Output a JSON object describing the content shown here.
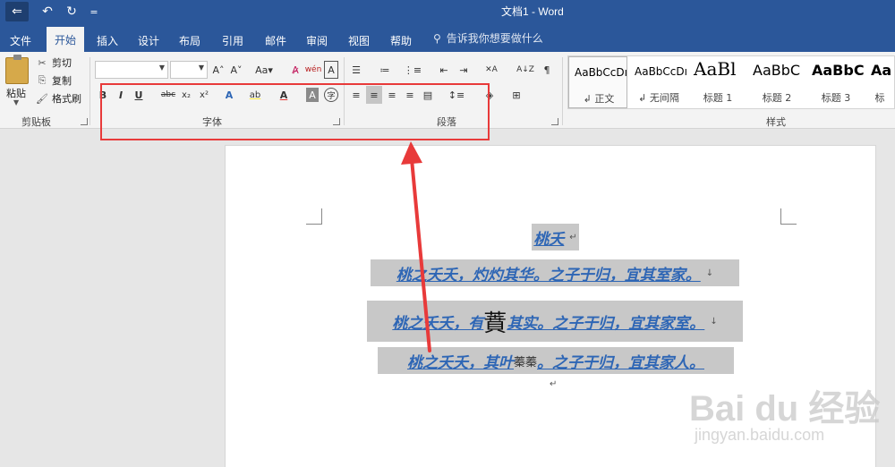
{
  "titlebar": {
    "title": "文档1  -  Word",
    "home_icon": "⇐",
    "undo_icon": "↶",
    "redo_icon": "↻",
    "more_icon": "="
  },
  "tabs": [
    {
      "label": "文件"
    },
    {
      "label": "开始"
    },
    {
      "label": "插入"
    },
    {
      "label": "设计"
    },
    {
      "label": "布局"
    },
    {
      "label": "引用"
    },
    {
      "label": "邮件"
    },
    {
      "label": "审阅"
    },
    {
      "label": "视图"
    },
    {
      "label": "帮助"
    }
  ],
  "tell_me": {
    "icon": "⚲",
    "text": "告诉我你想要做什么"
  },
  "clipboard": {
    "paste": "粘贴",
    "cut": "剪切",
    "copy": "复制",
    "format_painter": "格式刷",
    "group": "剪贴板",
    "cut_icon": "✂",
    "copy_icon": "⎘",
    "painter_icon": "🖌"
  },
  "font": {
    "group": "字体",
    "grow": "A˄",
    "shrink": "A˅",
    "case": "Aa▾",
    "clear": "A̷",
    "phonetic": "wén",
    "border": "A",
    "bold": "B",
    "italic": "I",
    "underline": "U",
    "strike": "abc",
    "sub": "x₂",
    "sup": "x²",
    "effects": "A",
    "highlight": "ab",
    "color": "A",
    "shade": "A",
    "enclose": "字"
  },
  "paragraph": {
    "group": "段落",
    "bullets": "☰",
    "numbering": "≔",
    "multilevel": "⋮≡",
    "decrease": "⇤",
    "increase": "⇥",
    "chinese": "✕A",
    "sort": "A↓Z",
    "marks": "¶",
    "align_left": "≡",
    "align_center": "≡",
    "align_right": "≡",
    "justify": "≡",
    "distributed": "▤",
    "spacing": "↕≡",
    "shading": "◈",
    "borders": "⊞"
  },
  "styles": {
    "group": "样式",
    "items": [
      {
        "preview": "AaBbCcDı",
        "name": "↲ 正文"
      },
      {
        "preview": "AaBbCcDı",
        "name": "↲ 无间隔"
      },
      {
        "preview": "AaBl",
        "name": "标题 1"
      },
      {
        "preview": "AaBbC",
        "name": "标题 2"
      },
      {
        "preview": "AaBbC",
        "name": "标题 3"
      },
      {
        "preview": "Aa",
        "name": "标"
      }
    ]
  },
  "document": {
    "title": "桃夭",
    "line1": "桃之夭夭，灼灼其华。之子于归，宜其室家。",
    "line2a": "桃之夭夭，有",
    "line2b": "蕡",
    "line2c": "其实。之子于归，宜其家室。",
    "line3a": "桃之夭夭，其叶",
    "line3b": "蓁蓁",
    "line3c": "。之子于归，宜其家人。",
    "para_mark": "↵",
    "line_mark": "↓"
  },
  "watermark": {
    "main": "Bai du 经验",
    "sub": "jingyan.baidu.com"
  },
  "colors": {
    "accent": "#2b579a",
    "highlight_box": "#e83a3a",
    "doc_text": "#2e66b5"
  }
}
